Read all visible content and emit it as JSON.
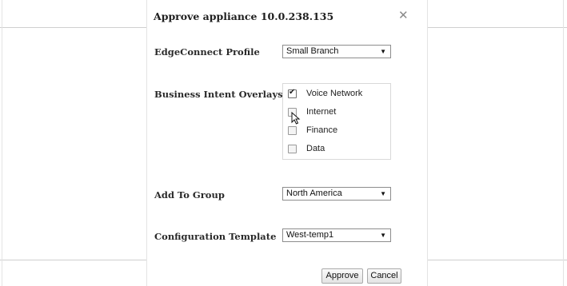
{
  "dialog": {
    "title": "Approve appliance 10.0.238.135",
    "close_icon": "close-icon"
  },
  "form": {
    "profile": {
      "label": "EdgeConnect Profile",
      "value": "Small Branch"
    },
    "overlays": {
      "label": "Business Intent Overlays",
      "options": [
        {
          "label": "Voice Network",
          "checked": true
        },
        {
          "label": "Internet",
          "checked": false
        },
        {
          "label": "Finance",
          "checked": false
        },
        {
          "label": "Data",
          "checked": false
        }
      ]
    },
    "group": {
      "label": "Add To Group",
      "value": "North America"
    },
    "template": {
      "label": "Configuration Template",
      "value": "West-temp1"
    }
  },
  "actions": {
    "approve": "Approve",
    "cancel": "Cancel"
  }
}
